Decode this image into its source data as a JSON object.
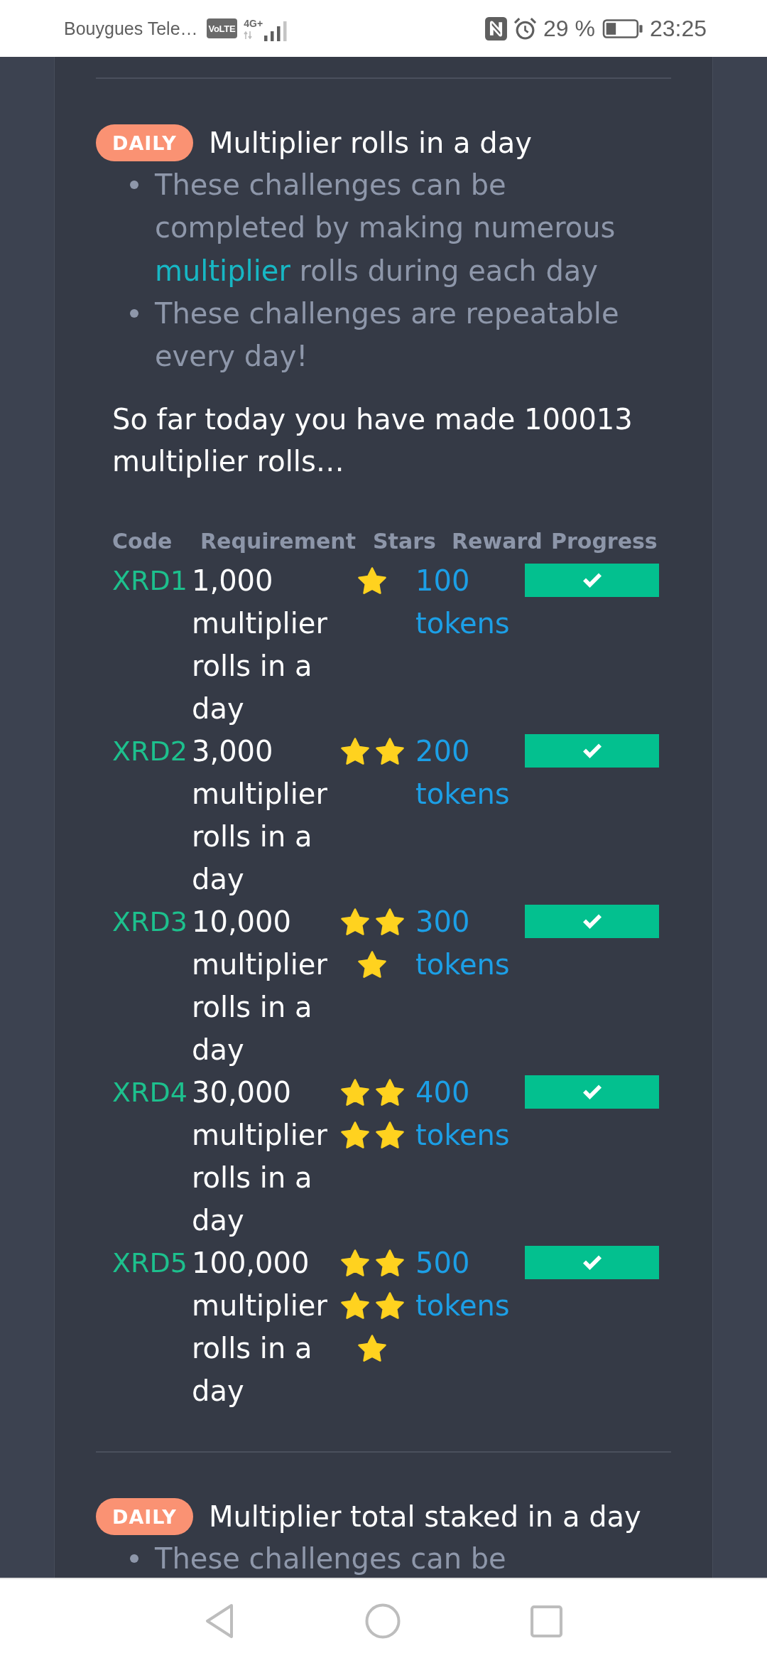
{
  "status_bar": {
    "carrier": "Bouygues Tele…",
    "volte": "VoLTE",
    "network": "4G+",
    "battery": "29 %",
    "time": "23:25"
  },
  "sections": [
    {
      "badge": "DAILY",
      "title": "Multiplier rolls in a day",
      "bullets": [
        {
          "segments": [
            {
              "kind": "text",
              "text": "These challenges can be completed by making numerous "
            },
            {
              "kind": "link",
              "text": "multiplier"
            },
            {
              "kind": "text",
              "text": " rolls during each day"
            }
          ]
        },
        {
          "segments": [
            {
              "kind": "text",
              "text": "These challenges are repeatable every day!"
            }
          ]
        }
      ],
      "summary": "So far today you have made 100013 multiplier rolls…",
      "table": {
        "columns": [
          "Code",
          "Requirement",
          "Stars",
          "Reward",
          "Progress"
        ],
        "rows": [
          {
            "code": "XRD1",
            "requirement": "1,000 multiplier rolls in a day",
            "star_icons": [
              {
                "filled": true
              }
            ],
            "reward": "100 tokens",
            "level": 1
          },
          {
            "code": "XRD2",
            "requirement": "3,000 multiplier rolls in a day",
            "star_icons": [
              {
                "filled": true
              },
              {
                "filled": true
              }
            ],
            "reward": "200 tokens",
            "level": 1
          },
          {
            "code": "XRD3",
            "requirement": "10,000 multiplier rolls in a day",
            "star_icons": [
              {
                "filled": true
              },
              {
                "filled": true
              },
              {
                "filled": true
              }
            ],
            "reward": "300 tokens",
            "level": 1
          },
          {
            "code": "XRD4",
            "requirement": "30,000 multiplier rolls in a day",
            "star_icons": [
              {
                "filled": true
              },
              {
                "filled": true
              },
              {
                "filled": true
              },
              {
                "filled": true
              }
            ],
            "reward": "400 tokens",
            "level": 1
          },
          {
            "code": "XRD5",
            "requirement": "100,000 multiplier rolls in a day",
            "star_icons": [
              {
                "filled": true
              },
              {
                "filled": true
              },
              {
                "filled": true
              },
              {
                "filled": true
              },
              {
                "filled": true
              }
            ],
            "reward": "500 tokens",
            "level": 1
          }
        ]
      }
    },
    {
      "badge": "DAILY",
      "title": "Multiplier total staked in a day",
      "bullets": [
        {
          "segments": [
            {
              "kind": "text",
              "text": "These challenges can be"
            }
          ]
        }
      ]
    }
  ]
}
